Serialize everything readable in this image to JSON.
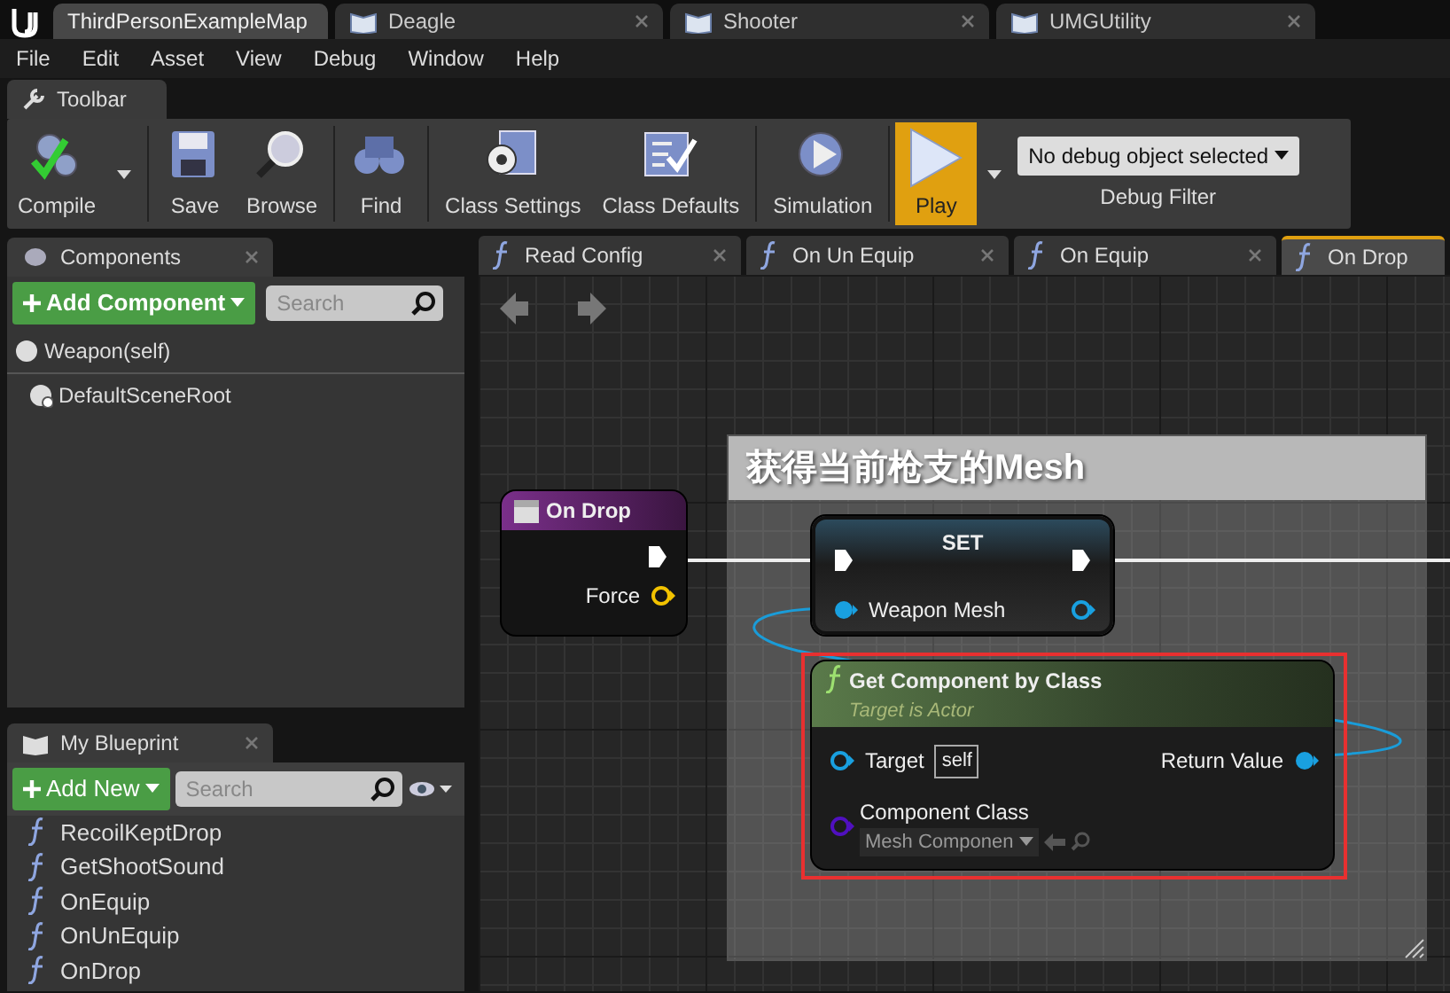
{
  "doc_tabs": [
    {
      "label": "ThirdPersonExampleMap",
      "selected": true,
      "kind": "level"
    },
    {
      "label": "Deagle",
      "selected": false,
      "kind": "blueprint"
    },
    {
      "label": "Shooter",
      "selected": false,
      "kind": "blueprint"
    },
    {
      "label": "UMGUtility",
      "selected": false,
      "kind": "blueprint"
    }
  ],
  "menu": [
    "File",
    "Edit",
    "Asset",
    "View",
    "Debug",
    "Window",
    "Help"
  ],
  "toolbar_tab": "Toolbar",
  "toolbar": {
    "buttons": [
      {
        "label": "Compile",
        "kind": "compile",
        "dropdown": true
      },
      {
        "label": "Save",
        "kind": "save"
      },
      {
        "label": "Browse",
        "kind": "browse"
      },
      {
        "label": "Find",
        "kind": "find"
      },
      {
        "label": "Class Settings",
        "kind": "class_settings"
      },
      {
        "label": "Class Defaults",
        "kind": "class_defaults"
      },
      {
        "label": "Simulation",
        "kind": "simulation"
      },
      {
        "label": "Play",
        "kind": "play",
        "dropdown": true
      }
    ],
    "debug_filter": {
      "value": "No debug object selected",
      "label": "Debug Filter"
    }
  },
  "components": {
    "title": "Components",
    "add_button": "Add Component",
    "search": {
      "placeholder": "Search"
    },
    "items": [
      {
        "label": "Weapon(self)",
        "children": [
          {
            "label": "DefaultSceneRoot"
          }
        ]
      }
    ]
  },
  "my_blueprint": {
    "title": "My Blueprint",
    "add_button": "Add New",
    "search": {
      "placeholder": "Search"
    },
    "functions": [
      "RecoilKeptDrop",
      "GetShootSound",
      "OnEquip",
      "OnUnEquip",
      "OnDrop"
    ]
  },
  "graph_tabs": [
    {
      "label": "Read Config",
      "selected": false
    },
    {
      "label": "On Un Equip",
      "selected": false
    },
    {
      "label": "On Equip",
      "selected": false
    },
    {
      "label": "On Drop",
      "selected": true
    }
  ],
  "graph": {
    "comment": "获得当前枪支的Mesh",
    "event_node": {
      "title": "On Drop",
      "pins": [
        "Force"
      ]
    },
    "set_node": {
      "title": "SET",
      "pins": [
        "Weapon Mesh"
      ]
    },
    "call_node": {
      "title": "Get Component by Class",
      "subtitle": "Target is Actor",
      "target_label": "Target",
      "target_value": "self",
      "return_label": "Return Value",
      "class_label": "Component Class",
      "class_value": "Mesh Componen",
      "highlighted": true
    }
  }
}
